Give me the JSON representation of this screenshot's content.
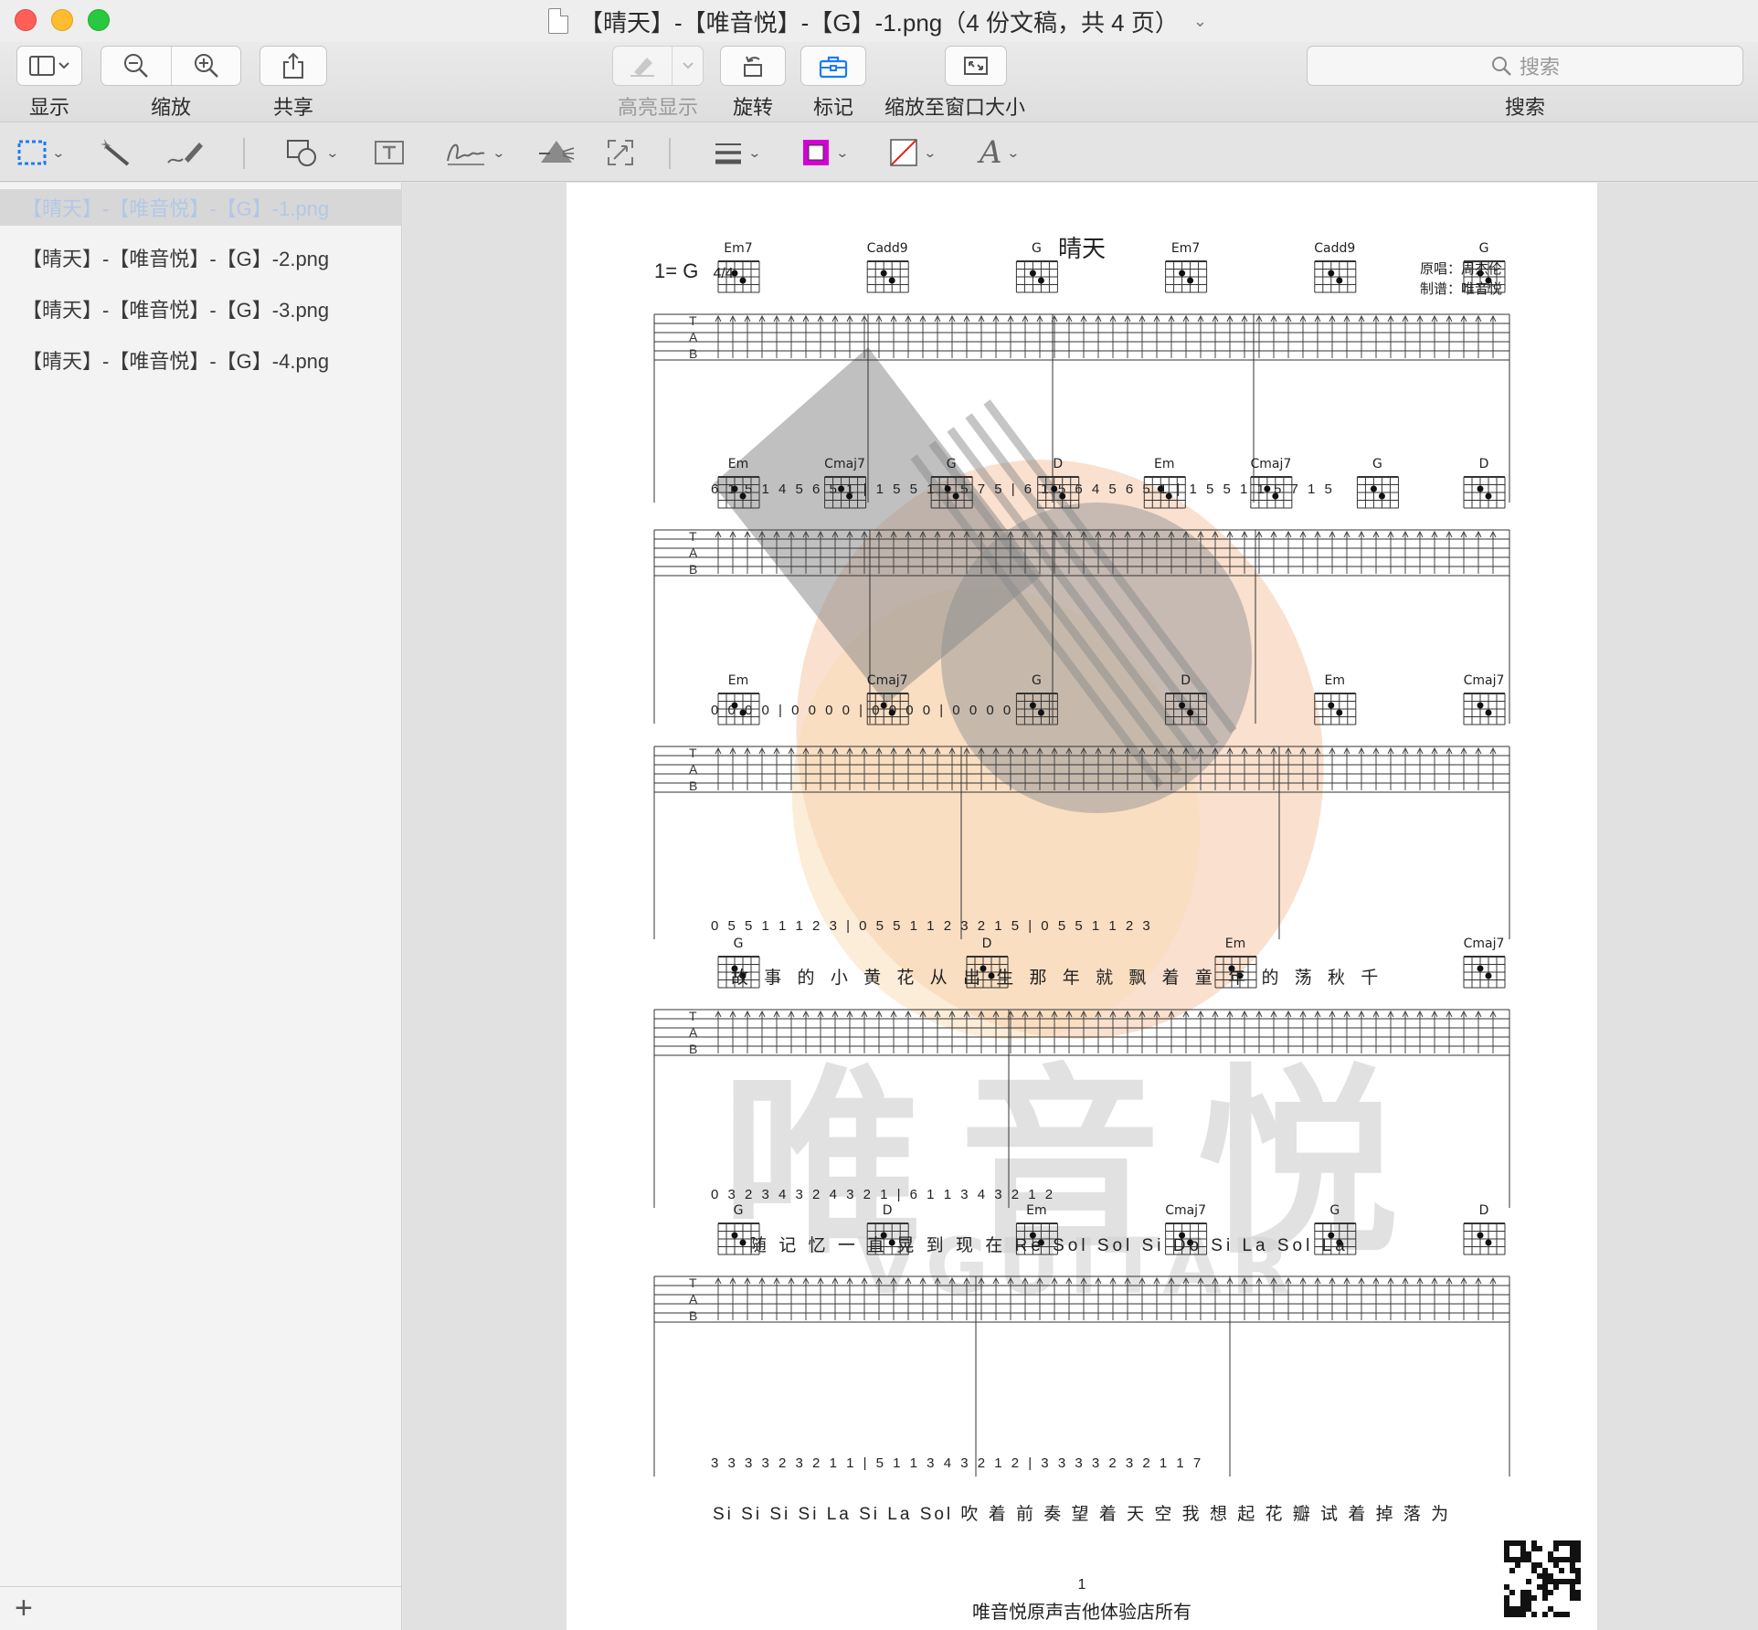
{
  "window": {
    "title": "【晴天】-【唯音悦】-【G】-1.png（4 份文稿，共 4 页）"
  },
  "toolbar": {
    "view_label": "显示",
    "zoom_label": "缩放",
    "share_label": "共享",
    "highlight_label": "高亮显示",
    "rotate_label": "旋转",
    "markup_label": "标记",
    "fit_label": "缩放至窗口大小",
    "search_placeholder": "搜索",
    "search_label": "搜索"
  },
  "sidebar": {
    "items": [
      {
        "label": "【晴天】-【唯音悦】-【G】-1.png",
        "selected": true
      },
      {
        "label": "【晴天】-【唯音悦】-【G】-2.png",
        "selected": false
      },
      {
        "label": "【晴天】-【唯音悦】-【G】-3.png",
        "selected": false
      },
      {
        "label": "【晴天】-【唯音悦】-【G】-4.png",
        "selected": false
      }
    ],
    "add_symbol": "+"
  },
  "markup_colors": {
    "border": "#d400d4",
    "fill": "none-red-slash"
  },
  "sheet": {
    "title": "晴天",
    "key": "1= G",
    "time_signature": "4/4",
    "credit_singer": "原唱：周杰伦",
    "credit_arranger": "制谱：唯音悦",
    "watermark_brand": "唯音悦",
    "watermark_sub": "VGUITAR",
    "page_number": "1",
    "footer": "唯音悦原声吉他体验店所有",
    "systems": [
      {
        "chords": [
          "Em7",
          "Cadd9",
          "G",
          "Em7",
          "Cadd9",
          "G"
        ],
        "numbers": "6 1 5 1 4 5 6 5 1 | 1 5 5 1 1 5 7 5 | 6 1 5 6 4 5 6 5 1 | 1 5 5 1 1 5 7 1 5",
        "lyrics": ""
      },
      {
        "chords": [
          "Em",
          "Cmaj7",
          "G",
          "D",
          "Em",
          "Cmaj7",
          "G",
          "D"
        ],
        "numbers": "0 0 0 0 | 0 0 0 0 | 0 0 0 0 | 0 0 0 0",
        "lyrics": ""
      },
      {
        "chords": [
          "Em",
          "Cmaj7",
          "G",
          "D",
          "Em",
          "Cmaj7"
        ],
        "numbers": "0 5 5 1 1 1 2 3 | 0 5 5 1 1 2 3 2 1 5 | 0 5 5 1 1 2 3",
        "lyrics": "故 事 的 小   黄 花     从 出 生  那  年 就 飘   着     童 年 的  荡    秋 千"
      },
      {
        "chords": [
          "G",
          "D",
          "Em",
          "Cmaj7"
        ],
        "numbers": "0 3 2 3 4 3 2 4 3 2 1 | 6 1 1 3 4 3 2 1 2",
        "lyrics": "随      记 忆 一 直 晃 到 现    在       Re  Sol  Sol  Si    Do    Si   La  Sol  La"
      },
      {
        "chords": [
          "G",
          "D",
          "Em",
          "Cmaj7",
          "G",
          "D"
        ],
        "numbers": "3 3 3 3 2 3 2 1 1 | 5 1 1 3 4 3 2 1 2 | 3 3 3 3 2 3 2 1 1 7",
        "lyrics": "Si  Si  Si  Si  La Si La   Sol    吹 着 前 奏  望 着 天 空 我   想 起 花 瓣  试 着 掉   落   为"
      }
    ]
  }
}
